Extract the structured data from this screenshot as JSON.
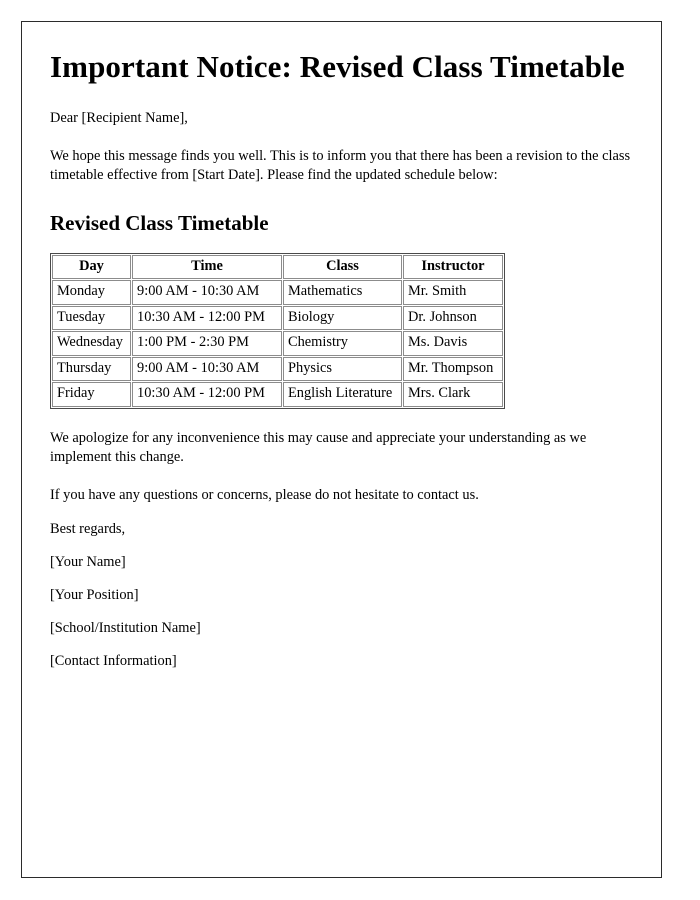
{
  "document": {
    "title": "Important Notice: Revised Class Timetable",
    "salutation": "Dear [Recipient Name],",
    "intro_paragraph": "We hope this message finds you well. This is to inform you that there has been a revision to the class timetable effective from [Start Date]. Please find the updated schedule below:",
    "section_heading": "Revised Class Timetable",
    "apology_paragraph": "We apologize for any inconvenience this may cause and appreciate your understanding as we implement this change.",
    "contact_paragraph": "If you have any questions or concerns, please do not hesitate to contact us.",
    "closing": "Best regards,",
    "signature": {
      "name": "[Your Name]",
      "position": "[Your Position]",
      "institution": "[School/Institution Name]",
      "contact": "[Contact Information]"
    }
  },
  "timetable": {
    "columns": [
      "Day",
      "Time",
      "Class",
      "Instructor"
    ],
    "rows": [
      {
        "day": "Monday",
        "time": "9:00 AM - 10:30 AM",
        "class": "Mathematics",
        "instructor": "Mr. Smith"
      },
      {
        "day": "Tuesday",
        "time": "10:30 AM - 12:00 PM",
        "class": "Biology",
        "instructor": "Dr. Johnson"
      },
      {
        "day": "Wednesday",
        "time": "1:00 PM - 2:30 PM",
        "class": "Chemistry",
        "instructor": "Ms. Davis"
      },
      {
        "day": "Thursday",
        "time": "9:00 AM - 10:30 AM",
        "class": "Physics",
        "instructor": "Mr. Thompson"
      },
      {
        "day": "Friday",
        "time": "10:30 AM - 12:00 PM",
        "class": "English Literature",
        "instructor": "Mrs. Clark"
      }
    ]
  },
  "colors": {
    "page_border": "#2b2b2b",
    "table_outer_border": "#4a4a4a",
    "table_cell_border": "#8c8c8c",
    "text": "#000000",
    "background": "#ffffff"
  }
}
